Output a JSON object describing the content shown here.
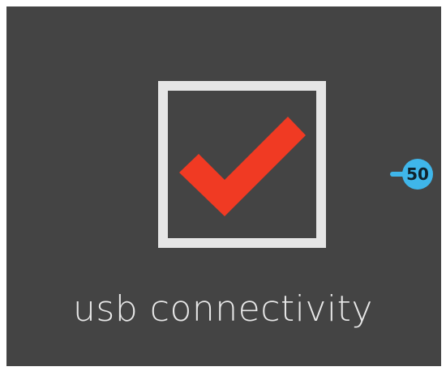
{
  "tile": {
    "caption": "usb connectivity",
    "icon": "checkmark-in-box-icon",
    "colors": {
      "background": "#444444",
      "box_outline": "#e6e6e6",
      "checkmark": "#f03a23",
      "badge": "#3fb6ea"
    }
  },
  "marker": {
    "label": "50"
  }
}
